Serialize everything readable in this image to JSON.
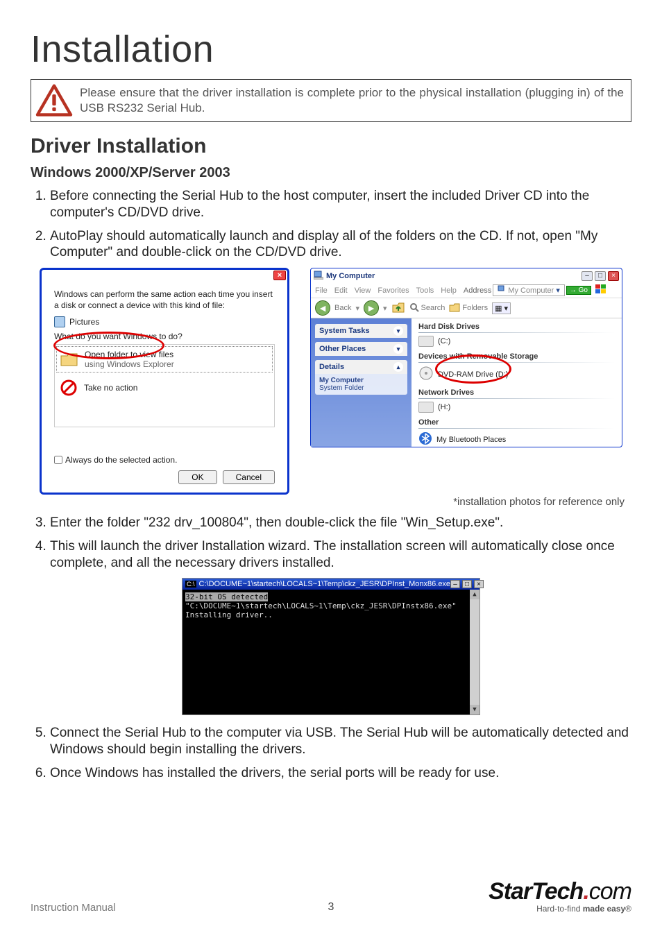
{
  "page": {
    "title": "Installation",
    "subtitle": "Driver Installation",
    "sub2": "Windows 2000/XP/Server 2003"
  },
  "warning": "Please ensure that the driver installation is complete prior to the physical installation (plugging in) of the USB RS232 Serial Hub.",
  "steps_a": {
    "s1": "Before connecting the Serial Hub to the host computer, insert the included Driver CD into the computer's CD/DVD drive.",
    "s2": "AutoPlay should automatically launch and display all of the folders on the CD.  If not, open \"My Computer\" and double-click on the CD/DVD drive."
  },
  "autoplay": {
    "intro": "Windows can perform the same action each time you insert a disk or connect a device with this kind of file:",
    "pictures": "Pictures",
    "question": "What do you want Windows to do?",
    "opt1": {
      "title": "Open folder to view files",
      "sub": "using Windows Explorer"
    },
    "opt2": "Take no action",
    "always": "Always do the selected action.",
    "ok": "OK",
    "cancel": "Cancel"
  },
  "mycomp": {
    "title": "My Computer",
    "menu": {
      "file": "File",
      "edit": "Edit",
      "view": "View",
      "fav": "Favorites",
      "tools": "Tools",
      "help": "Help"
    },
    "addr": {
      "label": "Address",
      "value": "My Computer",
      "go": "Go"
    },
    "toolbar": {
      "back": "Back",
      "search": "Search",
      "folders": "Folders"
    },
    "side": {
      "system": "System Tasks",
      "other": "Other Places",
      "details": "Details",
      "det_l1": "My Computer",
      "det_l2": "System Folder"
    },
    "sections": {
      "hdd": "Hard Disk Drives",
      "c": "(C:)",
      "removable": "Devices with Removable Storage",
      "dvd": "DVD-RAM Drive (D:)",
      "net": "Network Drives",
      "h": "(H:)",
      "other": "Other",
      "bt": "My Bluetooth Places"
    }
  },
  "caption": "*installation photos for reference only",
  "steps_b": {
    "s3": "Enter the folder \"232 drv_100804\", then double-click the file \"Win_Setup.exe\".",
    "s4": "This will launch the driver Installation wizard.  The installation screen will automatically close once complete, and all the necessary drivers installed."
  },
  "cmd": {
    "title": "C:\\DOCUME~1\\startech\\LOCALS~1\\Temp\\ckz_JESR\\DPInst_Monx86.exe",
    "l1": "32-bit OS detected",
    "l2": "\"C:\\DOCUME~1\\startech\\LOCALS~1\\Temp\\ckz_JESR\\DPInstx86.exe\"",
    "l3": "Installing driver.."
  },
  "steps_c": {
    "s5": "Connect the Serial Hub to the computer via USB.  The Serial Hub will be automatically detected and Windows should begin installing the drivers.",
    "s6": "Once Windows has installed the drivers, the serial ports will be ready for use."
  },
  "footer": {
    "im": "Instruction Manual",
    "page": "3",
    "logo": {
      "brand_a": "StarTech",
      "brand_b": "com",
      "tag_a": "Hard-to-find ",
      "tag_b": "made easy",
      "tag_c": "®"
    }
  }
}
